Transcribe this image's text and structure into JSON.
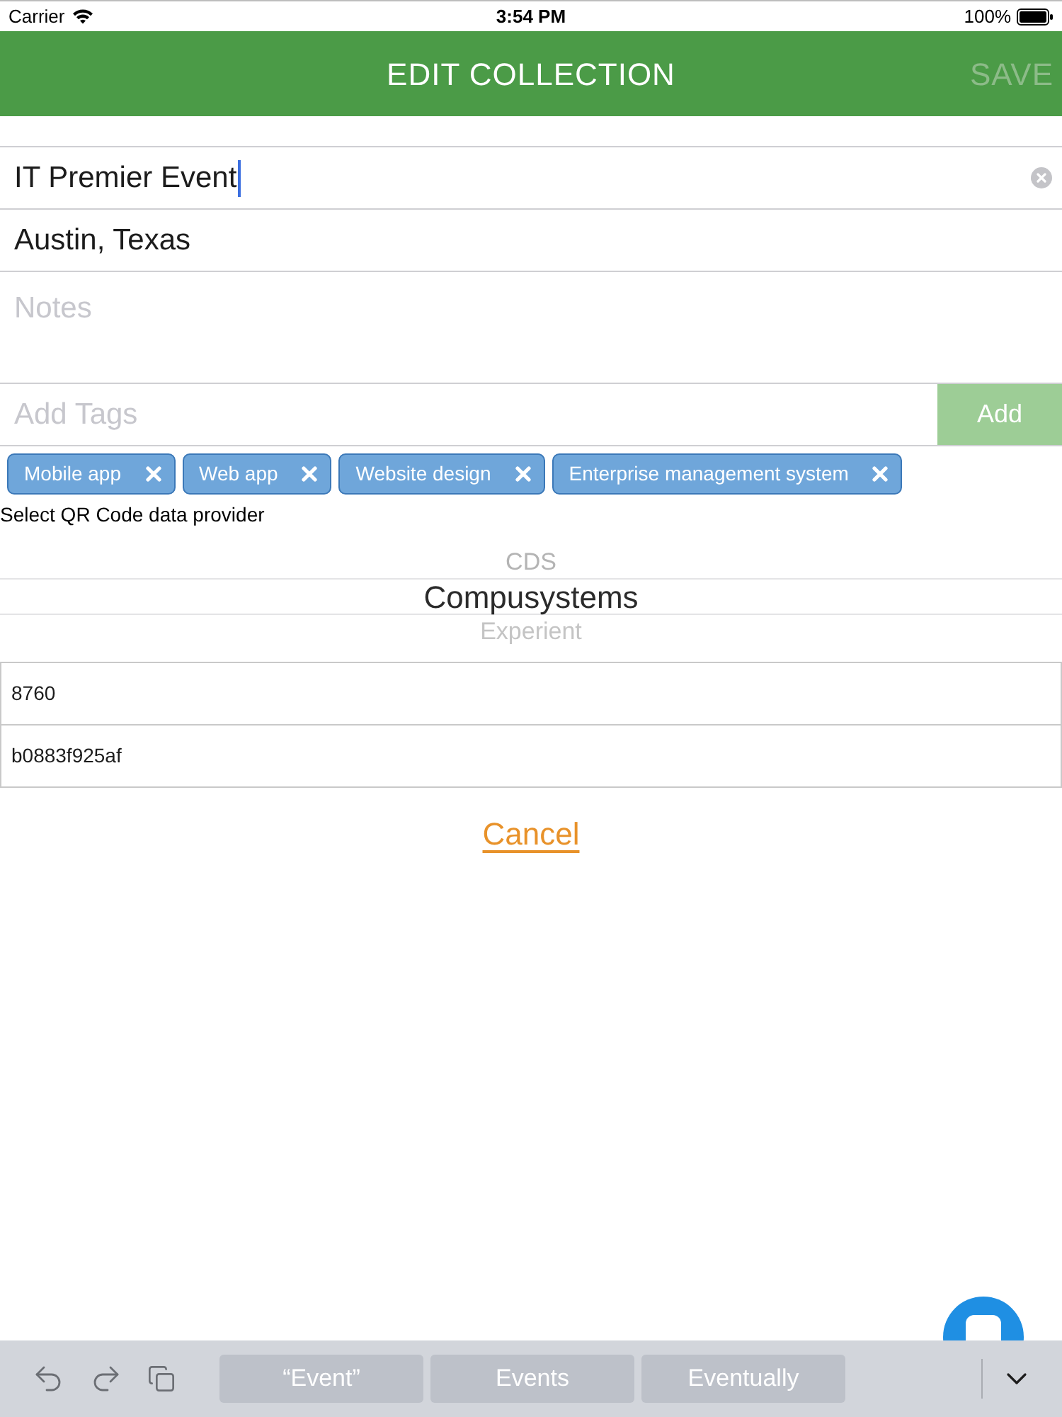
{
  "status_bar": {
    "carrier": "Carrier",
    "time": "3:54 PM",
    "battery": "100%"
  },
  "header": {
    "title": "EDIT COLLECTION",
    "save_button": {
      "label": "SAVE",
      "disabled": true
    }
  },
  "form": {
    "fields": [
      {
        "value": "IT Premier Event",
        "focused": true,
        "clearable": true
      },
      {
        "value": "Austin, Texas",
        "focused": false,
        "clearable": false
      }
    ],
    "notes": {
      "placeholder": "Notes"
    },
    "tag_input": {
      "placeholder": "Add Tags"
    },
    "add_button": {
      "label": "Add",
      "disabled": true
    }
  },
  "tags": [
    {
      "label": "Mobile app"
    },
    {
      "label": "Web app"
    },
    {
      "label": "Website design"
    },
    {
      "label": "Enterprise management system"
    }
  ],
  "provider_picker": {
    "label": "Select QR Code data provider",
    "options": [
      {
        "label": "CDS",
        "selected": false
      },
      {
        "label": "Compusystems",
        "selected": true
      },
      {
        "label": "Experient",
        "selected": false
      }
    ]
  },
  "credential_fields": [
    {
      "value": "8760"
    },
    {
      "value": "b0883f925af"
    }
  ],
  "cancel_link": {
    "label": "Cancel"
  },
  "keyboard_bar": {
    "suggestions": [
      "“Event”",
      "Events",
      "Eventually"
    ]
  }
}
